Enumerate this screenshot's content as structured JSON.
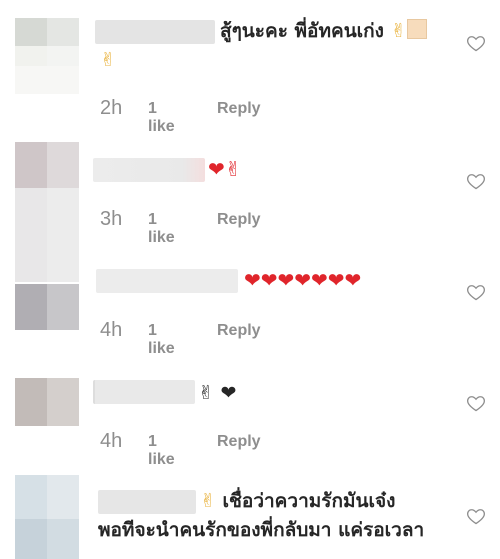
{
  "comments": [
    {
      "text": "สู้ๆนะคะ พี่อัทคนเก่ง",
      "emoji_after": "✌",
      "emoji_line2": "✌",
      "time": "2h",
      "likes": "1 like",
      "reply": "Reply"
    },
    {
      "text": "",
      "emoji_after": "❤✌",
      "time": "3h",
      "likes": "1 like",
      "reply": "Reply"
    },
    {
      "text": "",
      "emoji_after": "❤❤❤❤❤❤❤",
      "time": "4h",
      "likes": "1 like",
      "reply": "Reply"
    },
    {
      "text": "",
      "emoji_after": "✌ ❤",
      "time": "4h",
      "likes": "1 like",
      "reply": "Reply"
    },
    {
      "emoji_before": "✌",
      "text_line1": "เชื่อว่าความรักมันเจ๋ง",
      "text_line2": "พอทีจะนำคนรักของพี่กลับมา แค่รอเวลา"
    }
  ],
  "colors": {
    "text": "#262626",
    "meta": "#8e8e8e",
    "heart_outline": "#8e8e8e",
    "emoji_heart": "#e0252b"
  },
  "icons": [
    "heart-outline-icon",
    "victory-hand-emoji",
    "red-heart-emoji"
  ]
}
